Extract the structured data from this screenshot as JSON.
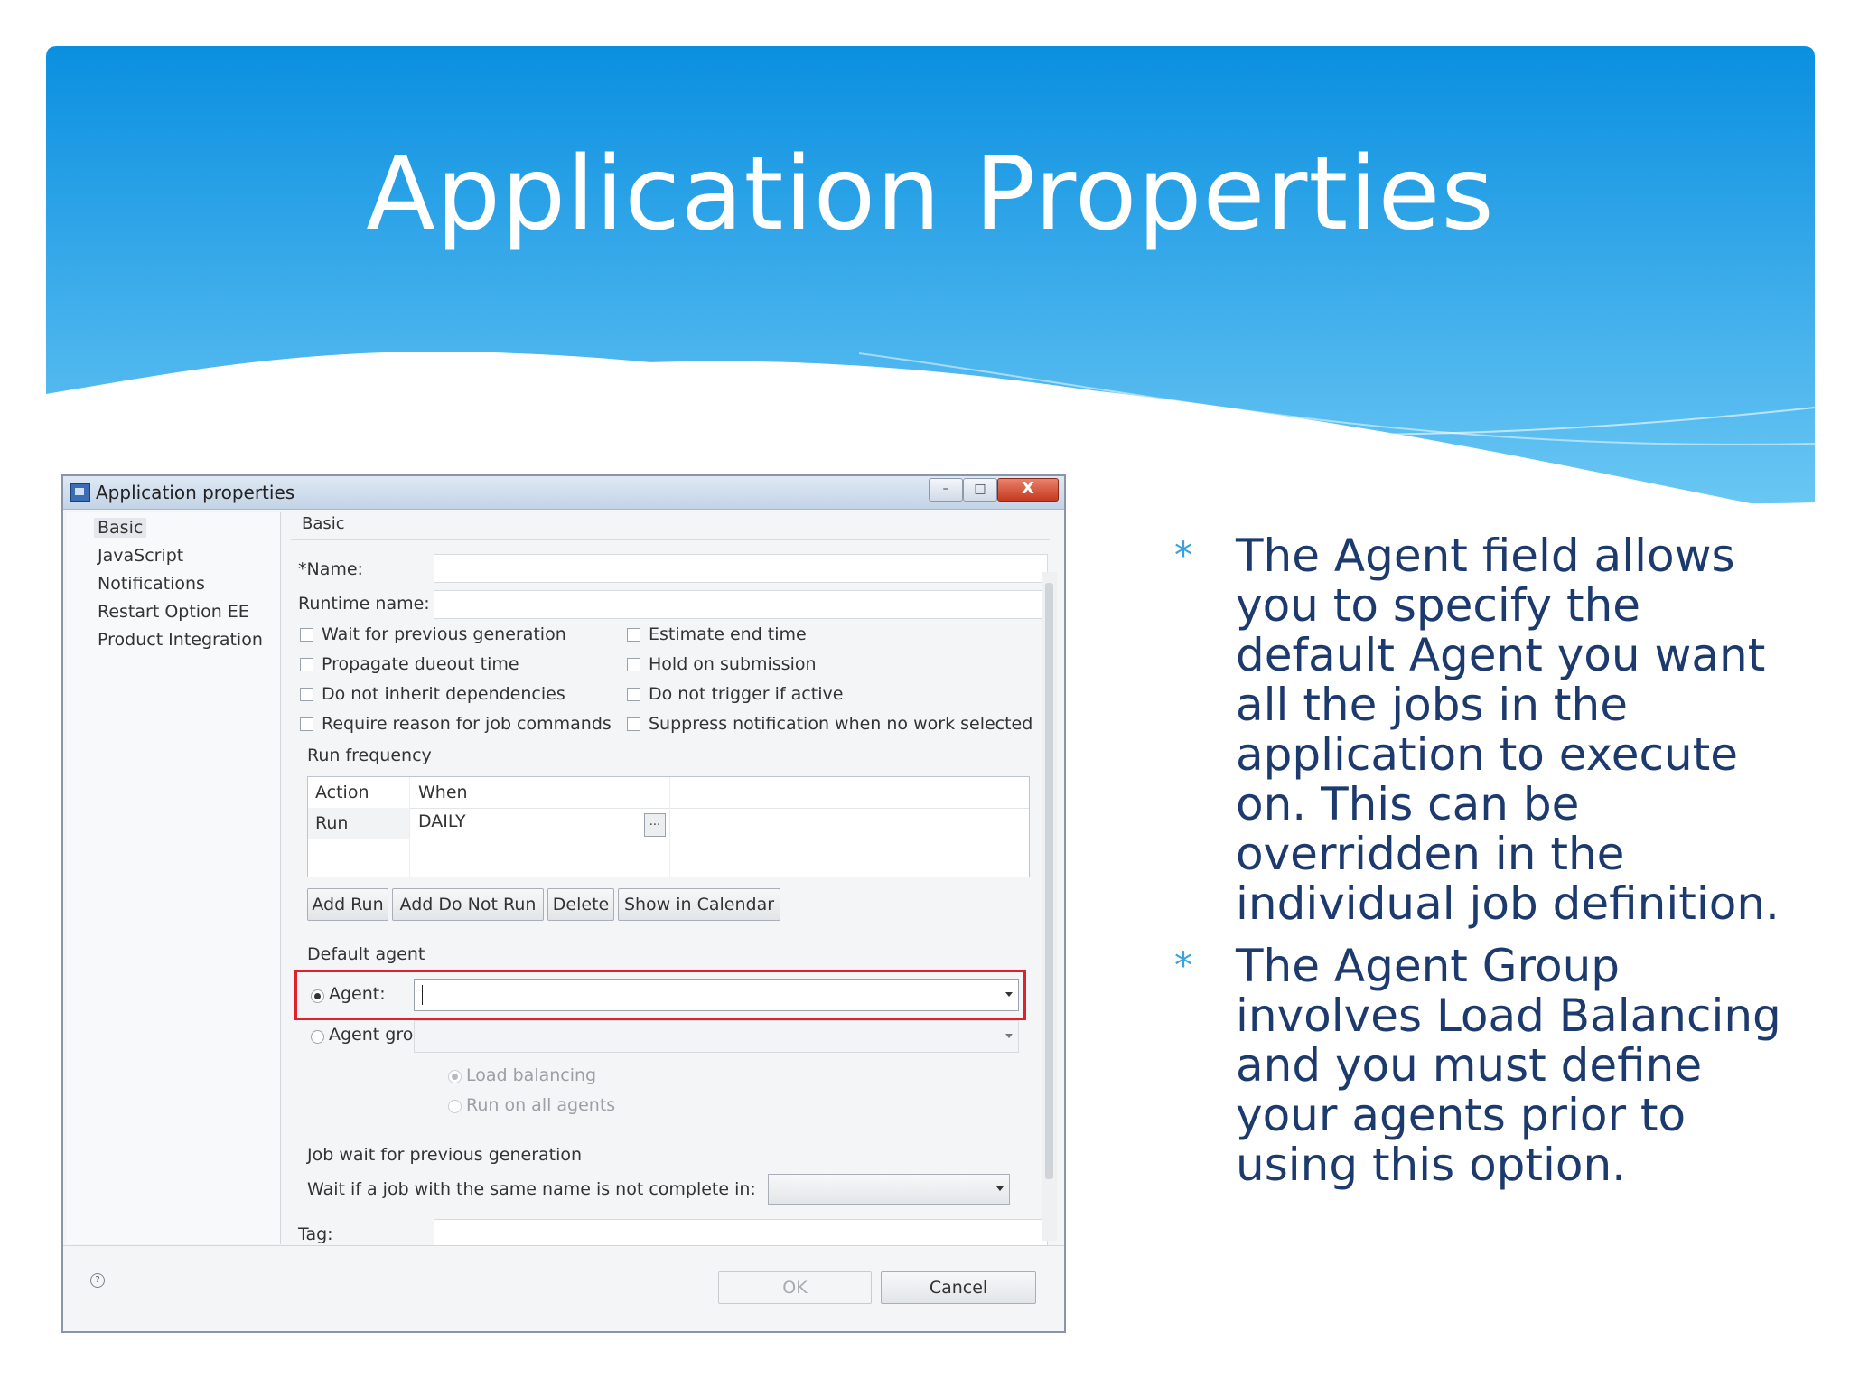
{
  "slide": {
    "title": "Application Properties",
    "banner_colors": {
      "top": "#0a8fe0",
      "bottom": "#6cc8f4"
    }
  },
  "dialog": {
    "title": "Application properties",
    "window_controls": [
      "–",
      "□",
      "X"
    ],
    "nav_items": [
      "Basic",
      "JavaScript",
      "Notifications",
      "Restart Option EE",
      "Product Integration"
    ],
    "section_header": "Basic",
    "fields": {
      "name_label": "*Name:",
      "name_value": "",
      "runtime_label": "Runtime name:",
      "runtime_value": ""
    },
    "checkboxes_left": [
      "Wait for previous generation",
      "Propagate dueout time",
      "Do not inherit dependencies",
      "Require reason for job commands"
    ],
    "checkboxes_right": [
      "Estimate end time",
      "Hold on submission",
      "Do not trigger if active",
      "Suppress notification when no work selected"
    ],
    "run_frequency": {
      "label": "Run frequency",
      "columns": [
        "Action",
        "When"
      ],
      "rows": [
        {
          "action": "Run",
          "when": "DAILY",
          "button": "..."
        }
      ],
      "buttons": [
        "Add Run",
        "Add Do Not Run",
        "Delete",
        "Show in Calendar"
      ]
    },
    "default_agent": {
      "label": "Default agent",
      "agent_label": "Agent:",
      "agent_value": "",
      "agent_group_label": "Agent group:",
      "load_balancing": "Load balancing",
      "run_on_all": "Run on all agents"
    },
    "job_wait": {
      "label": "Job wait for previous generation",
      "wait_label": "Wait if a job with the same name is not complete in:",
      "wait_value": ""
    },
    "tag_label": "Tag:",
    "ok": "OK",
    "cancel": "Cancel",
    "help_icon": "?",
    "highlight_color": "#e0202a"
  },
  "bullets": [
    "The Agent field allows you to specify the default Agent you want all the jobs in the application to execute on. This can be overridden in the individual job definition.",
    "The Agent Group involves Load Balancing and you must define your agents prior to using this option."
  ],
  "bullet_glyph": "*",
  "colors": {
    "bullet_text": "#1d3a6e",
    "bullet_mark": "#3aa0df"
  }
}
